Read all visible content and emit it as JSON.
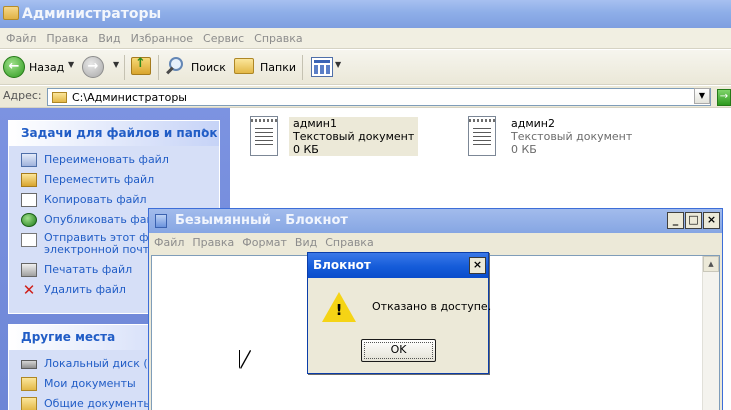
{
  "explorer": {
    "title": "Администраторы",
    "menu": [
      "Файл",
      "Правка",
      "Вид",
      "Избранное",
      "Сервис",
      "Справка"
    ],
    "toolbar": {
      "back_label": "Назад",
      "search_label": "Поиск",
      "folders_label": "Папки"
    },
    "address": {
      "label": "Адрес:",
      "value": "C:\\Администраторы"
    },
    "tasks_panel": {
      "title": "Задачи для файлов и папок",
      "items": [
        {
          "label": "Переименовать файл",
          "icon": "rename-icon"
        },
        {
          "label": "Переместить файл",
          "icon": "move-icon"
        },
        {
          "label": "Копировать файл",
          "icon": "copy-icon"
        },
        {
          "label": "Опубликовать файл",
          "icon": "publish-icon"
        },
        {
          "label_line1": "Отправить этот фай",
          "label_line2": "электронной почте",
          "icon": "email-icon"
        },
        {
          "label": "Печатать файл",
          "icon": "print-icon"
        },
        {
          "label": "Удалить файл",
          "icon": "delete-icon"
        }
      ]
    },
    "places_panel": {
      "title": "Другие места",
      "items": [
        {
          "label": "Локальный диск (C:",
          "icon": "disk-icon"
        },
        {
          "label": "Мои документы",
          "icon": "folder-icon"
        },
        {
          "label": "Общие документы",
          "icon": "folder-icon"
        }
      ]
    },
    "files": [
      {
        "name": "админ1",
        "type": "Текстовый документ",
        "size": "0 КБ",
        "selected": true
      },
      {
        "name": "админ2",
        "type": "Текстовый документ",
        "size": "0 КБ",
        "selected": false
      }
    ]
  },
  "notepad": {
    "title": "Безымянный - Блокнот",
    "menu": [
      "Файл",
      "Правка",
      "Формат",
      "Вид",
      "Справка"
    ],
    "buttons": {
      "minimize": "_",
      "maximize": "□",
      "close": "×"
    }
  },
  "dialog": {
    "title": "Блокнот",
    "message": "Отказано в доступе.",
    "ok_label": "OK",
    "close_glyph": "×"
  },
  "colors": {
    "xp_blue_title": "#155cd9",
    "inactive_title": "#8eaee8",
    "task_link": "#215dc6",
    "task_pane_bg": "#6d86d6"
  }
}
